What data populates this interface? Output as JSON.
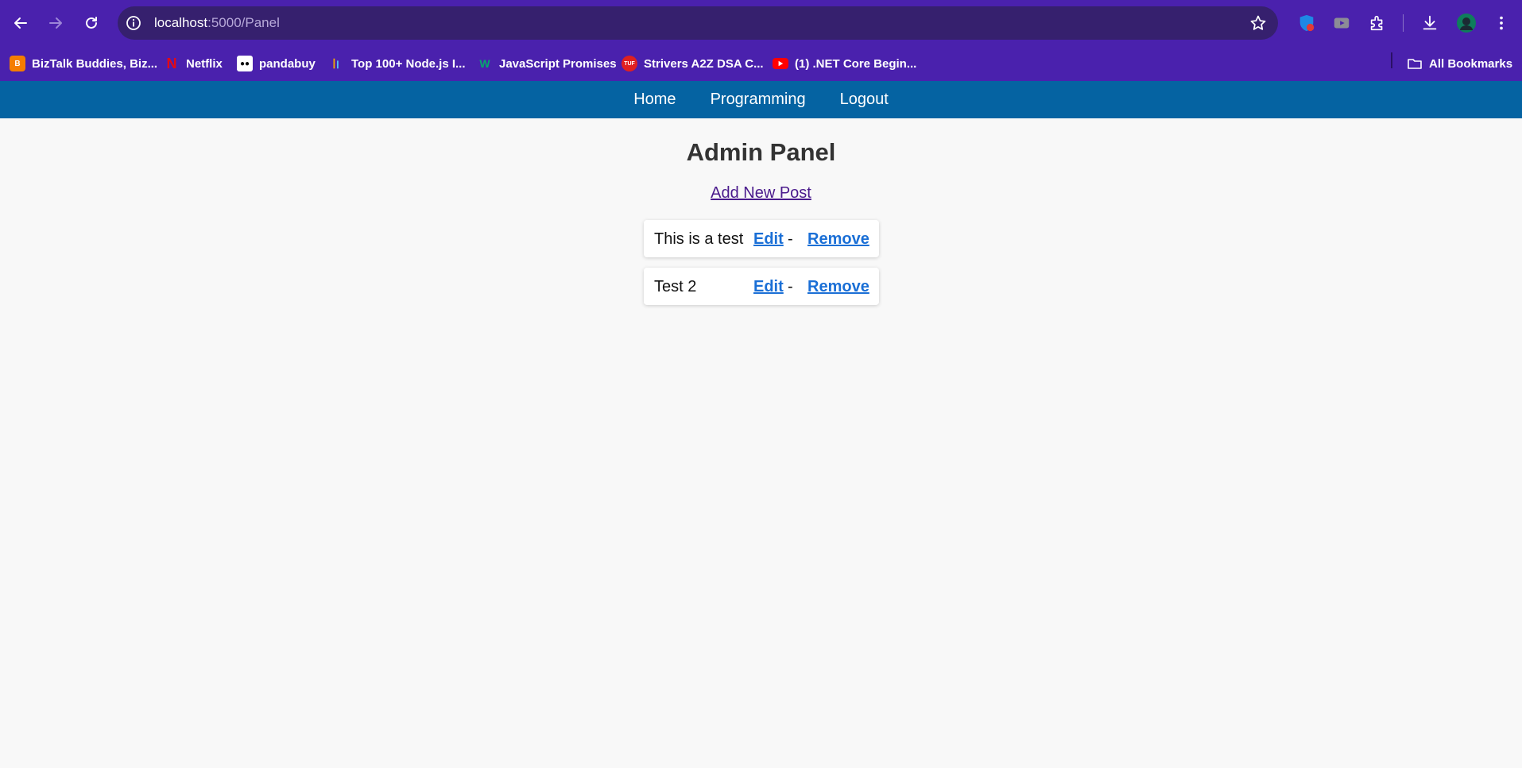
{
  "browser": {
    "url_host": "localhost",
    "url_path": ":5000/Panel",
    "bookmarks": [
      {
        "label": "BizTalk Buddies, Biz...",
        "icon": "blogger-icon",
        "color": "#f57d00"
      },
      {
        "label": "Netflix",
        "icon": "netflix-icon",
        "color": "#e50914"
      },
      {
        "label": "pandabuy",
        "icon": "panda-icon",
        "color": "#ffffff"
      },
      {
        "label": "Top 100+ Node.js I...",
        "icon": "chart-bars-icon",
        "color": "#f2a900"
      },
      {
        "label": "JavaScript Promises",
        "icon": "w3-icon",
        "color": "#04aa6d"
      },
      {
        "label": "Strivers A2Z DSA C...",
        "icon": "tuf-icon",
        "color": "#e02020"
      },
      {
        "label": "(1) .NET Core Begin...",
        "icon": "youtube-icon",
        "color": "#ff0000"
      }
    ],
    "all_bookmarks_label": "All Bookmarks"
  },
  "nav": {
    "items": [
      "Home",
      "Programming",
      "Logout"
    ]
  },
  "main": {
    "title": "Admin Panel",
    "add_link": "Add New Post",
    "posts": [
      {
        "title": "This is a test",
        "edit": "Edit",
        "sep": "-",
        "remove": "Remove"
      },
      {
        "title": "Test 2",
        "edit": "Edit",
        "sep": "-",
        "remove": "Remove"
      }
    ]
  },
  "colors": {
    "chrome": "#4a21ad",
    "navbar": "#0563a2",
    "link": "#1a6fd6"
  }
}
